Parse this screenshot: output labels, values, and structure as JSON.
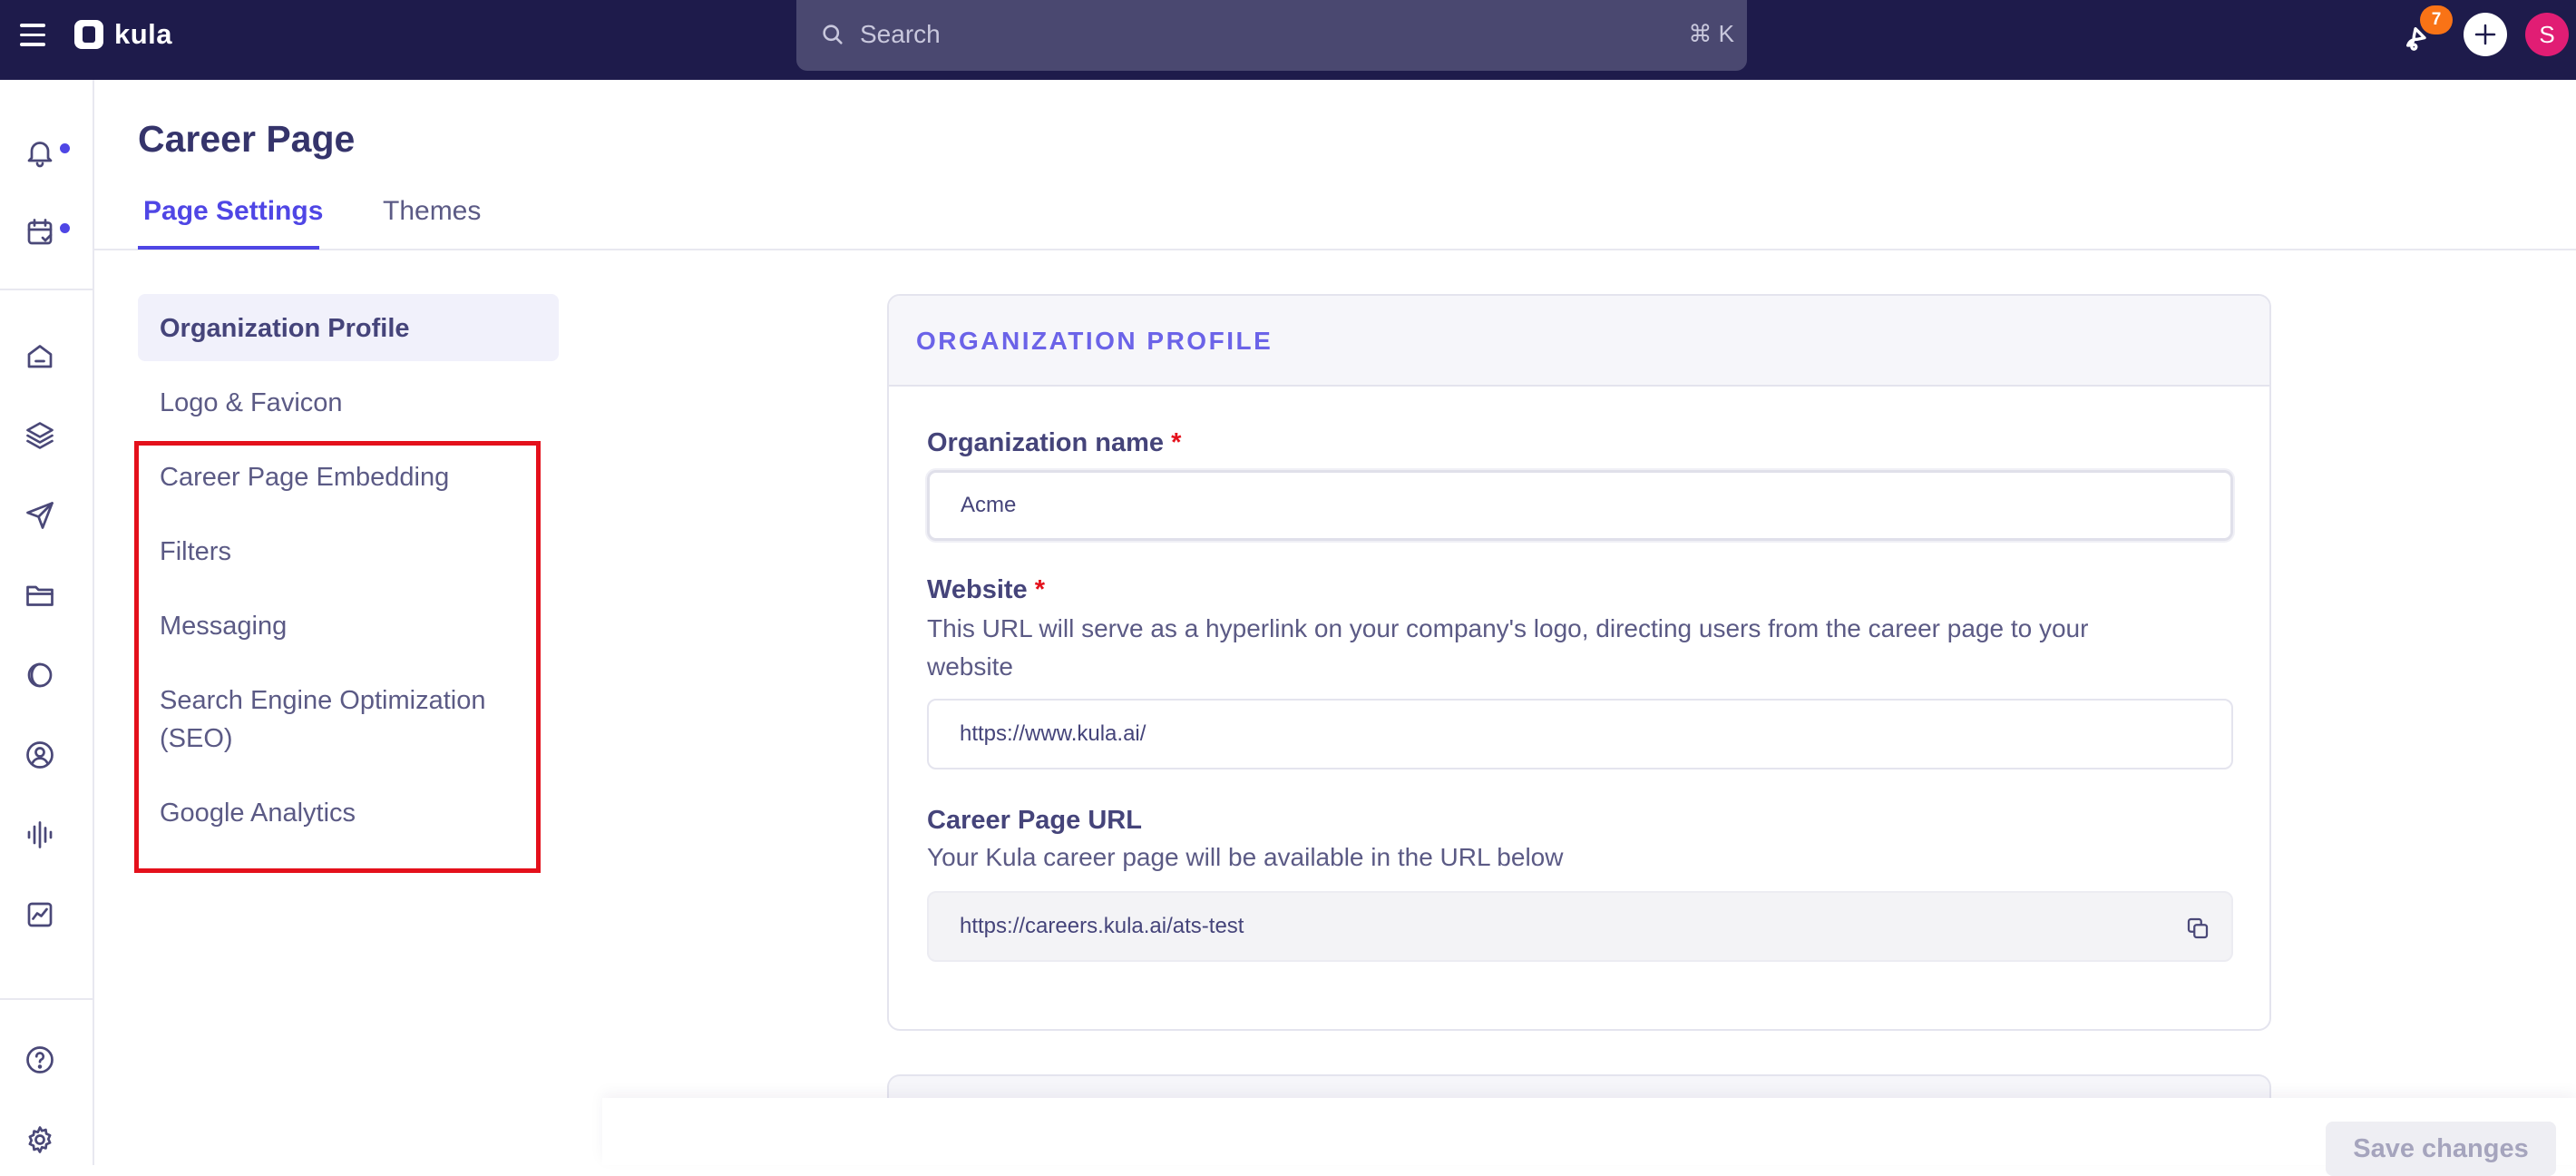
{
  "topbar": {
    "brand": "kula",
    "search_placeholder": "Search",
    "search_shortcut": "⌘ K",
    "notification_count": "7",
    "avatar_initial": "S"
  },
  "page": {
    "title": "Career Page",
    "tabs": [
      {
        "label": "Page Settings",
        "active": true
      },
      {
        "label": "Themes",
        "active": false
      }
    ]
  },
  "subnav": {
    "items": [
      {
        "label": "Organization Profile",
        "active": true
      },
      {
        "label": "Logo & Favicon"
      },
      {
        "label": "Career Page Embedding"
      },
      {
        "label": "Filters"
      },
      {
        "label": "Messaging"
      },
      {
        "label": "Search Engine Optimization"
      },
      {
        "label": "(SEO)"
      },
      {
        "label": "Google Analytics"
      }
    ]
  },
  "card": {
    "title": "ORGANIZATION PROFILE",
    "org_name": {
      "label": "Organization name",
      "required_mark": "*",
      "value": "Acme"
    },
    "website": {
      "label": "Website",
      "required_mark": "*",
      "description_line1": "This URL will serve as a hyperlink on your company's logo, directing users from the career page to your",
      "description_line2": "website",
      "value": "https://www.kula.ai/"
    },
    "career_url": {
      "label": "Career Page URL",
      "description": "Your Kula career page will be available in the URL below",
      "value": "https://careers.kula.ai/ats-test"
    }
  },
  "footer": {
    "save_label": "Save changes"
  },
  "colors": {
    "topbar": "#1e1b4b",
    "accent": "#4f46e5",
    "highlight": "#e4101b",
    "badge": "#f97316",
    "avatar": "#e11d74"
  }
}
